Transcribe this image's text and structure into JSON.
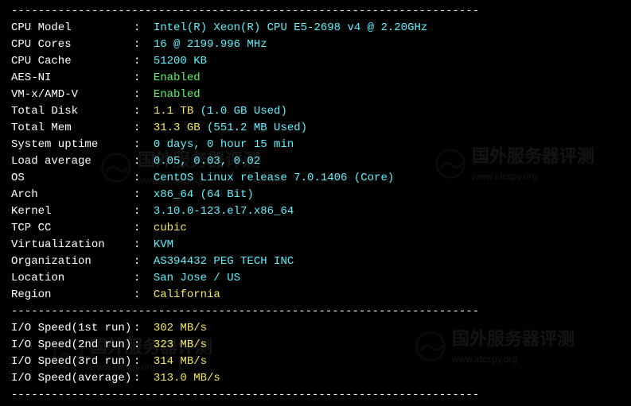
{
  "divider": "----------------------------------------------------------------------",
  "sysinfo": [
    {
      "label": "CPU Model",
      "value": "Intel(R) Xeon(R) CPU E5-2698 v4 @ 2.20GHz",
      "color": "cyan"
    },
    {
      "label": "CPU Cores",
      "value": "16 @ 2199.996 MHz",
      "color": "cyan"
    },
    {
      "label": "CPU Cache",
      "value": "51200 KB",
      "color": "cyan"
    },
    {
      "label": "AES-NI",
      "value": "Enabled",
      "color": "green"
    },
    {
      "label": "VM-x/AMD-V",
      "value": "Enabled",
      "color": "green"
    },
    {
      "label": "Total Disk",
      "value": "1.1 TB",
      "extra": " (1.0 GB Used)",
      "color": "yellow",
      "extra_color": "cyan"
    },
    {
      "label": "Total Mem",
      "value": "31.3 GB",
      "extra": " (551.2 MB Used)",
      "color": "yellow",
      "extra_color": "cyan"
    },
    {
      "label": "System uptime",
      "value": "0 days, 0 hour 15 min",
      "color": "cyan"
    },
    {
      "label": "Load average",
      "value": "0.05, 0.03, 0.02",
      "color": "cyan"
    },
    {
      "label": "OS",
      "value": "CentOS Linux release 7.0.1406 (Core)",
      "color": "cyan"
    },
    {
      "label": "Arch",
      "value": "x86_64 (64 Bit)",
      "color": "cyan"
    },
    {
      "label": "Kernel",
      "value": "3.10.0-123.el7.x86_64",
      "color": "cyan"
    },
    {
      "label": "TCP CC",
      "value": "cubic",
      "color": "yellow"
    },
    {
      "label": "Virtualization",
      "value": "KVM",
      "color": "cyan"
    },
    {
      "label": "Organization",
      "value": "AS394432 PEG TECH INC",
      "color": "cyan"
    },
    {
      "label": "Location",
      "value": "San Jose / US",
      "color": "cyan"
    },
    {
      "label": "Region",
      "value": "California",
      "color": "yellow"
    }
  ],
  "iospeed": [
    {
      "label": "I/O Speed(1st run)",
      "value": "302 MB/s",
      "color": "yellow"
    },
    {
      "label": "I/O Speed(2nd run)",
      "value": "323 MB/s",
      "color": "yellow"
    },
    {
      "label": "I/O Speed(3rd run)",
      "value": "314 MB/s",
      "color": "yellow"
    },
    {
      "label": "I/O Speed(average)",
      "value": "313.0 MB/s",
      "color": "yellow"
    }
  ],
  "watermark": {
    "cn": "国外服务器评测",
    "url": "www.idcspy.org"
  }
}
